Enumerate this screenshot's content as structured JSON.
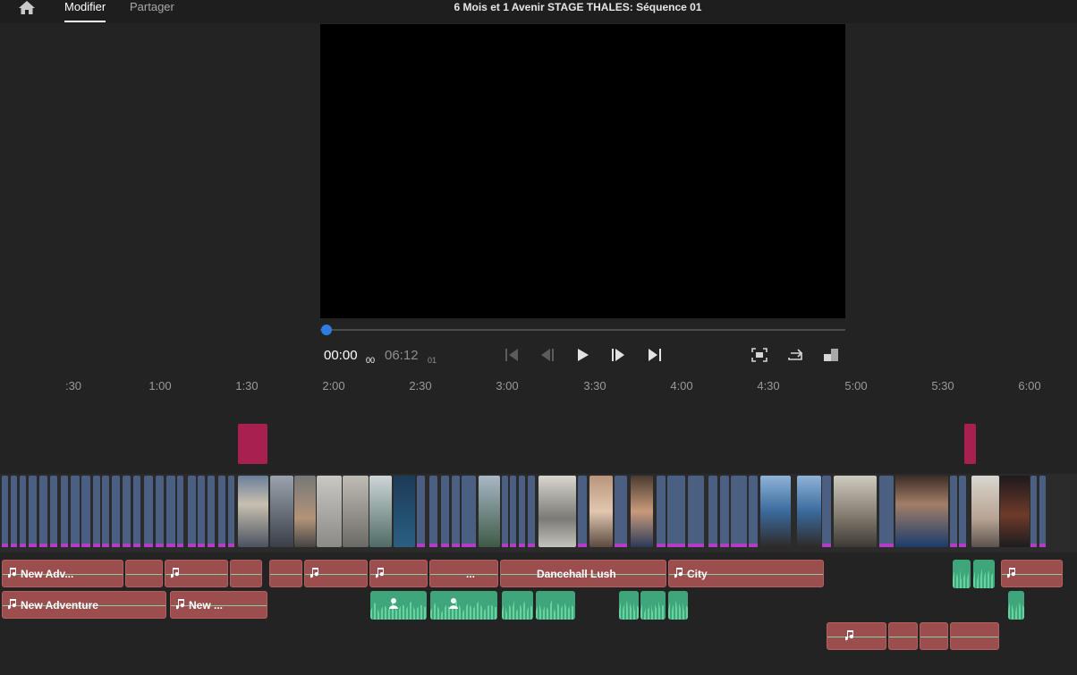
{
  "topbar": {
    "home_icon": "home-icon",
    "tabs": [
      {
        "label": "Modifier",
        "active": true
      },
      {
        "label": "Partager",
        "active": false
      }
    ],
    "project_title": "6 Mois et 1 Avenir STAGE THALES: Séquence  01"
  },
  "transport": {
    "current_time": "00:00",
    "current_frames": "00",
    "total_time": "06:12",
    "total_frames": "01",
    "playhead_fraction": 0.0,
    "icons": [
      "go-to-start-icon",
      "step-back-icon",
      "play-icon",
      "step-forward-icon",
      "go-to-end-icon",
      "fit-screen-icon",
      "share-icon",
      "layout-icon"
    ]
  },
  "ruler": {
    "labels": [
      ":30",
      "1:00",
      "1:30",
      "2:00",
      "2:30",
      "3:00",
      "3:30",
      "4:00",
      "4:30",
      "5:00",
      "5:30",
      "6:00"
    ]
  },
  "audio": {
    "track1": [
      "New Adv...",
      "",
      "",
      "",
      "",
      "",
      "",
      "...",
      "Dancehall Lush",
      "City",
      "",
      "",
      ""
    ],
    "track2": [
      "New Adventure",
      "New ..."
    ]
  },
  "colors": {
    "accent_blue": "#2f7de1",
    "marker": "#a8204f",
    "video_clip": "#4b5f82",
    "music_clip": "#9c4d4d",
    "voice_clip": "#3fa57a"
  }
}
